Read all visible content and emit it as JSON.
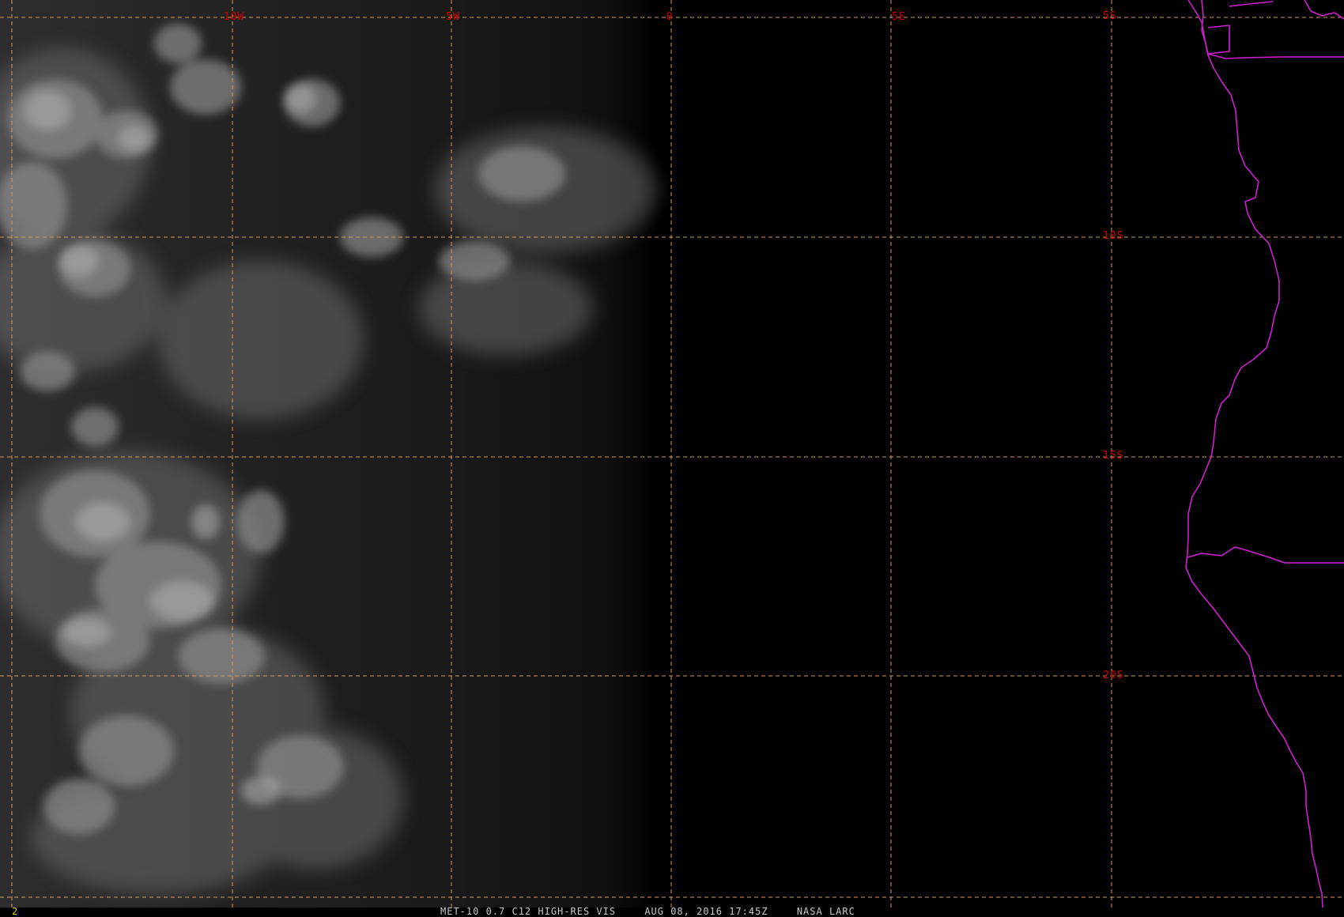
{
  "map": {
    "longitude_labels": [
      "10W",
      "5W",
      "0",
      "5E"
    ],
    "latitude_labels": [
      "5S",
      "10S",
      "15S",
      "20S"
    ],
    "colors": {
      "grid": "#d49a5a",
      "grid_label": "#d00000",
      "coastline": "#d21ed2",
      "frame_number": "#e0d000",
      "caption": "#c8c8c8"
    }
  },
  "footer": {
    "frame_number": "2",
    "product": "MET-10 0.7 C12 HIGH-RES VIS",
    "datetime": "AUG 08, 2016 17:45Z",
    "source": "NASA LARC"
  }
}
